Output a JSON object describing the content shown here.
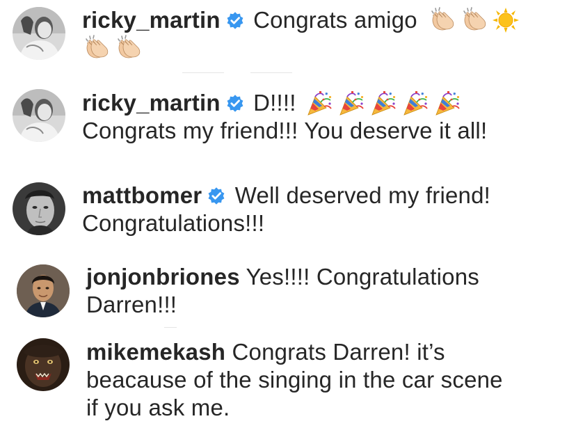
{
  "comments": [
    {
      "username": "ricky_martin",
      "verified": true,
      "text": "Congrats amigo",
      "emojis_line1": [
        "clapping-hands",
        "clapping-hands",
        "sun"
      ],
      "emojis_line2": [
        "clapping-hands",
        "clapping-hands"
      ]
    },
    {
      "username": "ricky_martin",
      "verified": true,
      "text": "D!!!!",
      "emojis_line1": [
        "party-popper",
        "party-popper",
        "party-popper",
        "party-popper",
        "party-popper"
      ],
      "line2": "Congrats my friend!!! You deserve it all!"
    },
    {
      "username": "mattbomer",
      "verified": true,
      "text": "Well deserved my friend!",
      "line2": "Congratulations!!!"
    },
    {
      "username": "jonjonbriones",
      "verified": false,
      "text": "Yes!!!! Congratulations",
      "line2": "Darren!!!"
    },
    {
      "username": "mikemekash",
      "verified": false,
      "text": "Congrats Darren! it’s",
      "line2": "beacause of the singing in the car scene",
      "line3": "if you ask me."
    }
  ],
  "colors": {
    "verified_blue": "#3897f0",
    "text": "#262626"
  }
}
